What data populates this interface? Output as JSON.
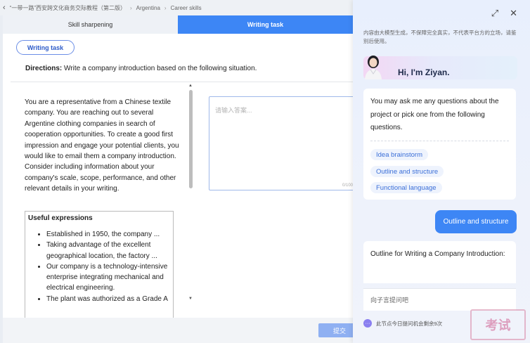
{
  "breadcrumb": {
    "back_icon": "back-arrow-icon",
    "course": "“一带一路”西安跨文化商务交际教程（第二版）",
    "country": "Argentina",
    "section": "Career skills"
  },
  "tabs": [
    {
      "label": "Skill sharpening",
      "active": false
    },
    {
      "label": "Writing task",
      "active": true
    }
  ],
  "task_pill": "Writing task",
  "directions": {
    "label": "Directions:",
    "text": "Write a company introduction based on the following situation."
  },
  "scenario": "You are a representative from a Chinese textile company. You are reaching out to several Argentine clothing companies in search of cooperation opportunities. To create a good first impression and engage your potential clients, you would like to email them a company introduction. Consider including information about your company's scale, scope, performance, and other relevant details in your writing.",
  "expressions": {
    "title": "Useful expressions",
    "items": [
      "Established in 1950, the company ...",
      "Taking advantage of the excellent geographical location, the factory ...",
      "Our company is a technology-intensive enterprise integrating mechanical and electrical engineering.",
      "The plant was authorized as a Grade A"
    ]
  },
  "answer": {
    "placeholder": "请输入答案...",
    "counter": "0/100"
  },
  "submit_label": "提交",
  "assistant": {
    "disclaimer": "内容由大模型生成，不保障完全真实，不代表平台方的立场，请鉴别后使用。",
    "greeting": "Hi, I'm Ziyan.",
    "intro": "You may ask me any questions about the project or pick one from the following questions.",
    "suggestions": [
      "Idea brainstorm",
      "Outline and structure",
      "Functional language"
    ],
    "user_message": "Outline and structure",
    "reply": "Outline for Writing a Company Introduction:",
    "input_placeholder": "向子言提问吧",
    "quota_text": "此节点今日提问机会剩余9次"
  },
  "watermark": "考试"
}
